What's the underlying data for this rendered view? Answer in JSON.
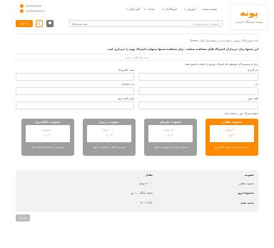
{
  "header": {
    "brand": "پونه",
    "brand_sub": "پوسته فروشگاه فارسی",
    "phone": "0990000000",
    "email": "info@website.ir",
    "nav": [
      "صفحه نخست",
      "آموزش",
      "اینستاگرام",
      "فرانت",
      "آلوم افزار"
    ],
    "search_placeholder": "جستجو در بین محصولات...",
    "search_category": "همه دسته ها",
    "cart_label": "ثبت اولیه",
    "cart_icon": "cart-icon",
    "user_icon": "user-icon"
  },
  "breadcrumb": "خانه / فروشگاه / پوستی / پکیج سه بار / پیشنمایش کامل: Demo",
  "notice": "این محتوا برای خریداران اشتراک قابل مشاهده میباشد. برای مشاهده محتوا میتوانید اشتراک پونه را خریداری کنید.",
  "form_title": "ثبت نام اکانت جدید",
  "form_hint": "برای به سیستم اگر میخواهید یک اشتراک موجود را انتخاب یا تغییر دهید.",
  "fields": {
    "username": "نام کاربری",
    "email": "پست الکترونیک",
    "first_name": "نام",
    "last_name": "نام خانوادگی",
    "password": "کلمه عبور",
    "password_confirm": "تکرار کلمه عبور"
  },
  "plans_label": "سطح اشتراک خود را انتخاب کنید",
  "plans": [
    {
      "title": "عضویت طلایی",
      "price": "۲۰۰۰۰ تومان",
      "period": "۳۰ روز",
      "desc": "دسترسی به تمام محتوای کامل پونه"
    },
    {
      "title": "عضویت نقره‌ای",
      "price": "۱۵۰۰۰ تومان",
      "period": "۳۰ روز",
      "desc": "دسترسی کامل با محدودیت دانلود"
    },
    {
      "title": "عضویت برنزی",
      "price": "۱۰۰۰۰ تومان",
      "period": "۱۵ روز",
      "desc": "دسترسی کامل با محدودیت دانلود"
    },
    {
      "title": "عضویت خاکستری",
      "price": "۵۰۰۰ تومان",
      "period": "۳۰ روز",
      "desc": "دسترسی به محدوده کتابخانه پونه"
    }
  ],
  "summary": {
    "membership_label": "عضویت",
    "membership_value": "عضویت طلایی",
    "amount_label": "مقدار",
    "amount_value": "۲۰۰۰۰ تومان",
    "total_label": "مجموع امروز",
    "total_value": "۲۰۰۰۰ تومان",
    "next_label": "تمدید بعدی",
    "next_value": "۳۰ روز",
    "trial_value": "نسخه رایگان - ۱ روز",
    "date_value": "۱۴۰۰/۰۴/۲۴"
  },
  "submit_label": "ثبت نام"
}
